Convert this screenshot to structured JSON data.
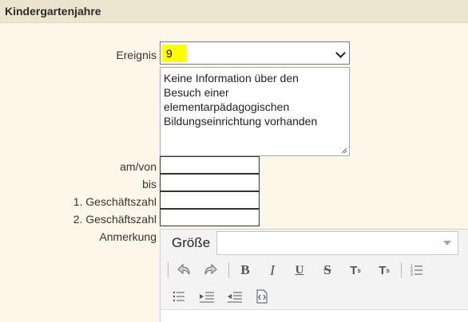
{
  "section": {
    "title": "Kindergartenjahre"
  },
  "form": {
    "ereignis_label": "Ereignis",
    "ereignis_value": "9",
    "description": "Keine Information über den Besuch einer elementarpädagogischen Bildungseinrichtung vorhanden",
    "am_von_label": "am/von",
    "bis_label": "bis",
    "gz1_label": "1. Geschäftszahl",
    "gz2_label": "2. Geschäftszahl",
    "anmerkung_label": "Anmerkung"
  },
  "editor": {
    "size_label": "Größe",
    "toolbar_icons": [
      "undo-icon",
      "redo-icon",
      "bold-icon",
      "italic-icon",
      "underline-icon",
      "strikethrough-icon",
      "subscript-icon",
      "superscript-icon",
      "numbered-list-icon",
      "bulleted-list-icon",
      "decrease-indent-icon",
      "increase-indent-icon",
      "insert-field-icon"
    ]
  },
  "colors": {
    "header_bg": "#ece4cf",
    "page_bg": "#fdf7ea",
    "highlight": "#ffff00"
  }
}
